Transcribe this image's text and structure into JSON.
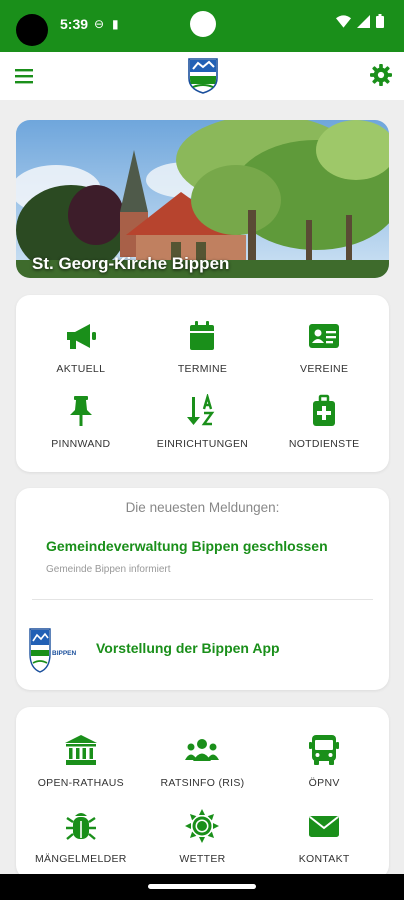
{
  "status_bar": {
    "time": "5:39"
  },
  "app": {
    "accent": "#1a8f1a"
  },
  "hero": {
    "caption": "St. Georg-Kirche Bippen"
  },
  "main_menu": [
    {
      "label": "AKTUELL",
      "icon": "megaphone-icon"
    },
    {
      "label": "TERMINE",
      "icon": "calendar-icon"
    },
    {
      "label": "VEREINE",
      "icon": "id-card-icon"
    },
    {
      "label": "PINNWAND",
      "icon": "pin-icon"
    },
    {
      "label": "EINRICHTUNGEN",
      "icon": "sort-az-icon"
    },
    {
      "label": "NOTDIENSTE",
      "icon": "first-aid-kit-icon"
    }
  ],
  "news": {
    "heading": "Die neuesten Meldungen:",
    "items": [
      {
        "title": "Gemeindeverwaltung Bippen geschlossen",
        "subtitle": "Gemeinde Bippen informiert"
      },
      {
        "title": "Vorstellung der Bippen App",
        "logo_text": "BIPPEN"
      }
    ]
  },
  "services_menu": [
    {
      "label": "OPEN-RATHAUS",
      "icon": "town-hall-icon"
    },
    {
      "label": "RATSINFO (RIS)",
      "icon": "people-group-icon"
    },
    {
      "label": "ÖPNV",
      "icon": "bus-icon"
    },
    {
      "label": "MÄNGELMELDER",
      "icon": "bug-icon"
    },
    {
      "label": "WETTER",
      "icon": "sun-icon"
    },
    {
      "label": "KONTAKT",
      "icon": "envelope-icon"
    }
  ]
}
